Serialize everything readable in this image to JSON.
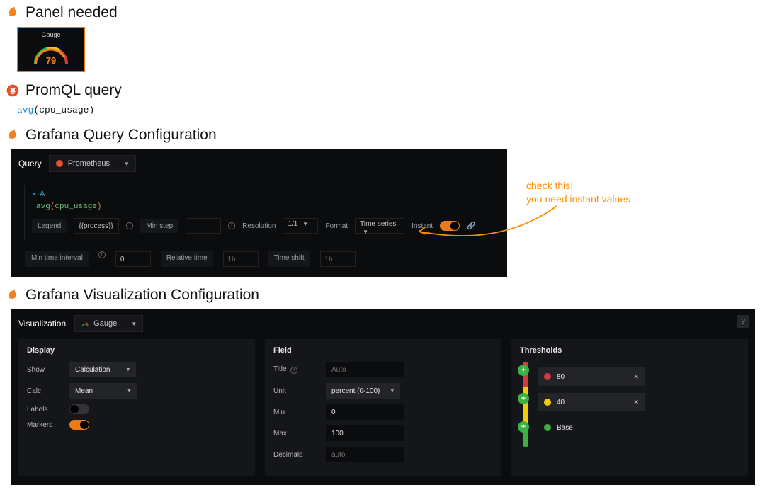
{
  "sections": {
    "panel": "Panel needed",
    "promql": "PromQL query",
    "queryconf": "Grafana Query Configuration",
    "vizconf": "Grafana Visualization Configuration"
  },
  "gauge_preview": {
    "title": "Gauge",
    "value": "79"
  },
  "promql_query": {
    "fn": "avg",
    "arg": "cpu_usage"
  },
  "annotation": {
    "line1": "check this!",
    "line2": "you need instant values"
  },
  "query_editor": {
    "tab": "Query",
    "datasource": "Prometheus",
    "row_letter": "A",
    "query_fn": "avg",
    "query_arg": "cpu_usage",
    "legend_label": "Legend",
    "legend_value": "{{process}}",
    "minstep_label": "Min step",
    "resolution_label": "Resolution",
    "resolution_value": "1/1",
    "format_label": "Format",
    "format_value": "Time series",
    "instant_label": "Instant",
    "bottom": {
      "min_interval_label": "Min time interval",
      "min_interval_value": "0",
      "reltime_label": "Relative time",
      "reltime_value": "1h",
      "timeshift_label": "Time shift",
      "timeshift_value": "1h"
    }
  },
  "viz_editor": {
    "tab": "Visualization",
    "viz_name": "Gauge",
    "display": {
      "header": "Display",
      "show_label": "Show",
      "show_value": "Calculation",
      "calc_label": "Calc",
      "calc_value": "Mean",
      "labels_label": "Labels",
      "markers_label": "Markers"
    },
    "field": {
      "header": "Field",
      "title_label": "Title",
      "title_value": "Auto",
      "unit_label": "Unit",
      "unit_value": "percent (0-100)",
      "min_label": "Min",
      "min_value": "0",
      "max_label": "Max",
      "max_value": "100",
      "decimals_label": "Decimals",
      "decimals_value": "auto"
    },
    "thresholds": {
      "header": "Thresholds",
      "t80": "80",
      "t40": "40",
      "base": "Base",
      "colors": {
        "high": "#d23b3b",
        "mid": "#f2cc0c",
        "low": "#3cb043"
      }
    }
  }
}
